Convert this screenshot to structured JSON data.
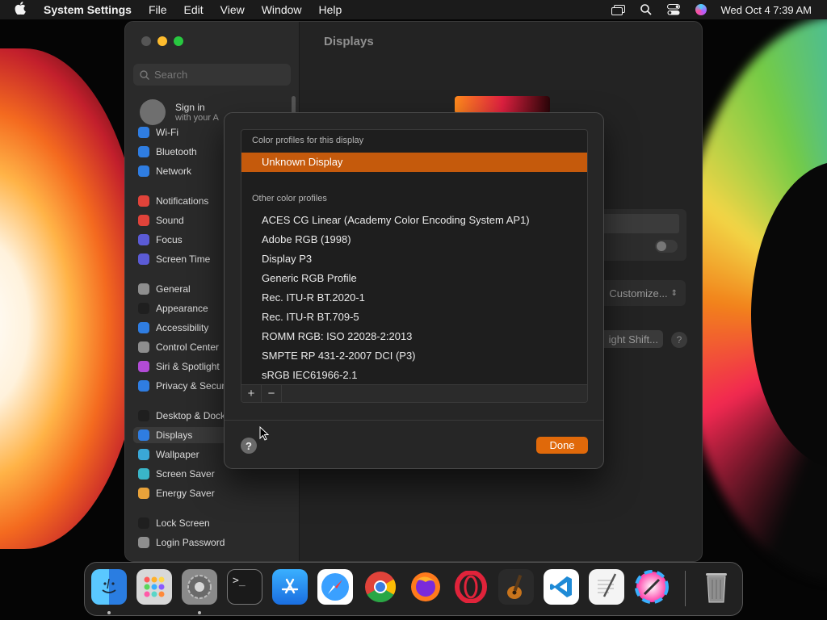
{
  "menubar": {
    "app_name": "System Settings",
    "menus": [
      "File",
      "Edit",
      "View",
      "Window",
      "Help"
    ],
    "clock": "Wed Oct 4  7:39 AM"
  },
  "sidebar": {
    "search_placeholder": "Search",
    "signin": {
      "line1": "Sign in",
      "line2": "with your A"
    },
    "items": [
      {
        "label": "Wi-Fi",
        "color": "#2f7de1"
      },
      {
        "label": "Bluetooth",
        "color": "#2f7de1"
      },
      {
        "label": "Network",
        "color": "#2f7de1"
      },
      {
        "label": "Notifications",
        "color": "#e0433a"
      },
      {
        "label": "Sound",
        "color": "#e0433a"
      },
      {
        "label": "Focus",
        "color": "#5b5bd6"
      },
      {
        "label": "Screen Time",
        "color": "#5b5bd6"
      },
      {
        "label": "General",
        "color": "#8e8e8e"
      },
      {
        "label": "Appearance",
        "color": "#1f1f1f"
      },
      {
        "label": "Accessibility",
        "color": "#2f7de1"
      },
      {
        "label": "Control Center",
        "color": "#8e8e8e"
      },
      {
        "label": "Siri & Spotlight",
        "color": "#b24bd6"
      },
      {
        "label": "Privacy & Secur",
        "color": "#2f7de1"
      },
      {
        "label": "Desktop & Dock",
        "color": "#1f1f1f"
      },
      {
        "label": "Displays",
        "color": "#2f7de1"
      },
      {
        "label": "Wallpaper",
        "color": "#3aa7d6"
      },
      {
        "label": "Screen Saver",
        "color": "#3ab5c8"
      },
      {
        "label": "Energy Saver",
        "color": "#e8a23a"
      },
      {
        "label": "Lock Screen",
        "color": "#1f1f1f"
      },
      {
        "label": "Login Password",
        "color": "#8e8e8e"
      }
    ]
  },
  "content": {
    "title": "Displays",
    "customize_label": "Customize...",
    "night_shift_label": "ight Shift...",
    "help_label": "?"
  },
  "sheet": {
    "section_current": "Color profiles for this display",
    "current_profile": "Unknown Display",
    "section_other": "Other color profiles",
    "profiles": [
      "ACES CG Linear (Academy Color Encoding System AP1)",
      "Adobe RGB (1998)",
      "Display P3",
      "Generic RGB Profile",
      "Rec. ITU-R BT.2020-1",
      "Rec. ITU-R BT.709-5",
      "ROMM RGB: ISO 22028-2:2013",
      "SMPTE RP 431-2-2007 DCI (P3)",
      "sRGB IEC61966-2.1"
    ],
    "add_label": "+",
    "remove_label": "−",
    "help_label": "?",
    "done_label": "Done",
    "accent_color": "#c55a0c"
  },
  "dock": {
    "apps": [
      "finder-icon",
      "launchpad-icon",
      "system-settings-icon",
      "terminal-icon",
      "app-store-icon",
      "safari-icon",
      "chrome-icon",
      "firefox-icon",
      "opera-icon",
      "garageband-icon",
      "vscode-icon",
      "textedit-icon",
      "color-picker-icon",
      "trash-icon"
    ]
  }
}
